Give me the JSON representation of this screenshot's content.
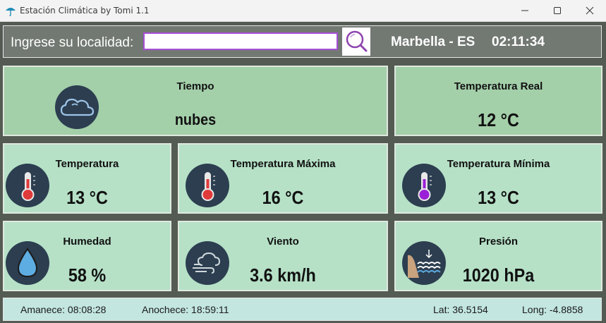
{
  "window": {
    "title": "Estación Climática by Tomi 1.1",
    "minimize_icon": "minimize-icon",
    "maximize_icon": "maximize-icon",
    "close_icon": "close-icon"
  },
  "search": {
    "label": "Ingrese su localidad:",
    "value": "",
    "button_icon": "search-icon",
    "accent_color": "#a64fd6"
  },
  "header": {
    "location": "Marbella - ES",
    "time": "02:11:34"
  },
  "cards": {
    "weather": {
      "title": "Tiempo",
      "value": "nubes",
      "icon": "cloud-icon"
    },
    "real_temp": {
      "title": "Temperatura Real",
      "value": "12 °C"
    },
    "temperature": {
      "title": "Temperatura",
      "value": "13 °C",
      "icon": "thermometer-icon"
    },
    "max_temp": {
      "title": "Temperatura Máxima",
      "value": "16 °C",
      "icon": "thermometer-icon"
    },
    "min_temp": {
      "title": "Temperatura Mínima",
      "value": "13 °C",
      "icon": "thermometer-cold-icon"
    },
    "humidity": {
      "title": "Humedad",
      "value": "58 %",
      "icon": "water-drop-icon"
    },
    "wind": {
      "title": "Viento",
      "value": "3.6 km/h",
      "icon": "wind-icon"
    },
    "pressure": {
      "title": "Presión",
      "value": "1020 hPa",
      "icon": "pressure-icon"
    }
  },
  "footer": {
    "sunrise": "Amanece: 08:08:28",
    "sunset": "Anochece: 18:59:11",
    "lat": "Lat: 36.5154",
    "long": "Long: -4.8858"
  },
  "colors": {
    "background": "#545b53",
    "card_green": "#a3cfa9",
    "card_mint": "#b6e1c7",
    "footer": "#c3e6e0",
    "icon_circle": "#2c3e50"
  }
}
